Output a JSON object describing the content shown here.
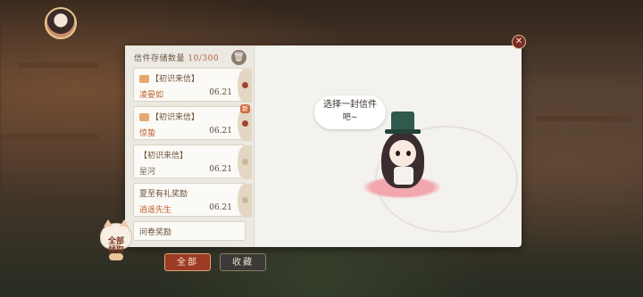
{
  "storage": {
    "label": "信件存储数量",
    "count": "10/300"
  },
  "letters": [
    {
      "tag": "【初识来信】",
      "sender": "凌晏如",
      "date": "06.21",
      "sender_color": "#c0602f",
      "read": false,
      "new": false
    },
    {
      "tag": "【初识来信】",
      "sender": "惊蛰",
      "date": "06.21",
      "sender_color": "#c0602f",
      "read": false,
      "new": true
    },
    {
      "tag": "【初识来信】",
      "sender": "星河",
      "date": "06.21",
      "sender_color": "#7a6a5c",
      "read": true,
      "new": false
    },
    {
      "tag": "夏至有礼奖励",
      "sender": "逍遥先生",
      "date": "06.21",
      "sender_color": "#c0602f",
      "read": true,
      "new": false
    },
    {
      "tag": "问卷奖励",
      "sender": "",
      "date": "",
      "sender_color": "#7a6a5c",
      "read": true,
      "new": false
    }
  ],
  "speech": {
    "line1": "选择一封信件",
    "line2": "吧~"
  },
  "tabs": {
    "all": "全部",
    "favorites": "收藏"
  },
  "claim_all": {
    "line1": "全部",
    "line2": "领取"
  },
  "new_badge": "新",
  "icons": {
    "close": "close-icon",
    "trash": "trash-icon",
    "letter": "letter-icon"
  }
}
